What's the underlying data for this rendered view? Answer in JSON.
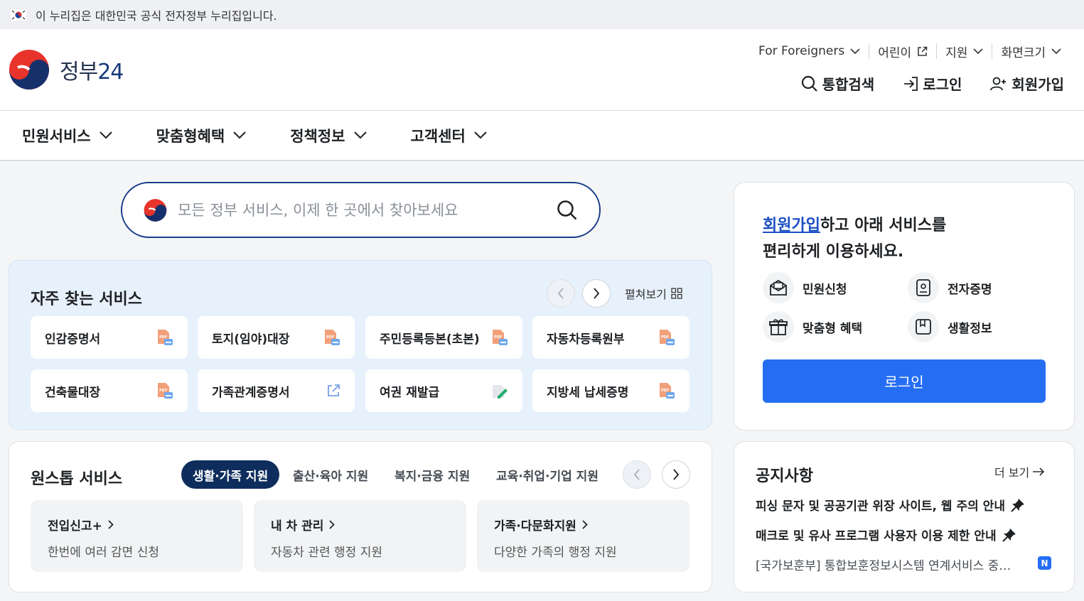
{
  "topbar": {
    "text": "이 누리집은 대한민국 공식 전자정부 누리집입니다."
  },
  "logo": {
    "text": "정부",
    "num": "24"
  },
  "utility_nav": [
    {
      "label": "For Foreigners",
      "icon": "chevron-down-icon"
    },
    {
      "label": "어린이",
      "icon": "external-link-icon"
    },
    {
      "label": "지원",
      "icon": "chevron-down-icon"
    },
    {
      "label": "화면크기",
      "icon": "chevron-down-icon"
    }
  ],
  "action_nav": [
    {
      "label": "통합검색",
      "icon": "search-icon"
    },
    {
      "label": "로그인",
      "icon": "login-icon"
    },
    {
      "label": "회원가입",
      "icon": "user-add-icon"
    }
  ],
  "gnb": [
    {
      "label": "민원서비스"
    },
    {
      "label": "맞춤형혜택"
    },
    {
      "label": "정책정보"
    },
    {
      "label": "고객센터"
    }
  ],
  "search": {
    "placeholder": "모든 정부 서비스, 이제 한 곳에서 찾아보세요"
  },
  "frequent": {
    "title": "자주 찾는 서비스",
    "expand": "펼쳐보기",
    "items": [
      {
        "label": "인감증명서",
        "icon": "pdf-doc-icon"
      },
      {
        "label": "토지(임야)대장",
        "icon": "pdf-doc-icon"
      },
      {
        "label": "주민등록등본(초본)",
        "icon": "pdf-doc-icon"
      },
      {
        "label": "자동차등록원부",
        "icon": "pdf-doc-icon"
      },
      {
        "label": "건축물대장",
        "icon": "pdf-doc-icon"
      },
      {
        "label": "가족관계증명서",
        "icon": "external-link-icon"
      },
      {
        "label": "여권 재발급",
        "icon": "edit-doc-icon"
      },
      {
        "label": "지방세 납세증명",
        "icon": "pdf-doc-icon"
      }
    ]
  },
  "onestop": {
    "title": "원스톱 서비스",
    "tabs": [
      {
        "label": "생활·가족 지원",
        "active": true
      },
      {
        "label": "출산·육아 지원"
      },
      {
        "label": "복지·금융 지원"
      },
      {
        "label": "교육·취업·기업 지원"
      }
    ],
    "cards": [
      {
        "title": "전입신고+",
        "desc": "한번에 여러 감면 신청"
      },
      {
        "title": "내 차 관리",
        "desc": "자동차 관련 행정 지원"
      },
      {
        "title": "가족·다문화지원",
        "desc": "다양한 가족의 행정 지원"
      }
    ]
  },
  "member": {
    "link": "회원가입",
    "line1_rest": "하고 아래 서비스를",
    "line2": "편리하게 이용하세요.",
    "items": [
      {
        "label": "민원신청",
        "icon": "mail-icon"
      },
      {
        "label": "전자증명",
        "icon": "certificate-icon"
      },
      {
        "label": "맞춤형 혜택",
        "icon": "gift-icon"
      },
      {
        "label": "생활정보",
        "icon": "bookmark-icon"
      }
    ],
    "login_label": "로그인"
  },
  "notices": {
    "title": "공지사항",
    "more": "더 보기",
    "items": [
      {
        "text": "피싱 문자 및 공공기관 위장 사이트, 웹 주의 안내",
        "pinned": true
      },
      {
        "text": "매크로 및 유사 프로그램 사용자 이용 제한 안내",
        "pinned": true
      },
      {
        "text": "[국가보훈부] 통합보훈정보시스템 연계서비스 중…",
        "pinned": false,
        "badge": "N"
      }
    ]
  },
  "colors": {
    "primary": "#256ef4",
    "navy": "#0e2d5c",
    "frequent_bg": "#e7f1fc"
  }
}
